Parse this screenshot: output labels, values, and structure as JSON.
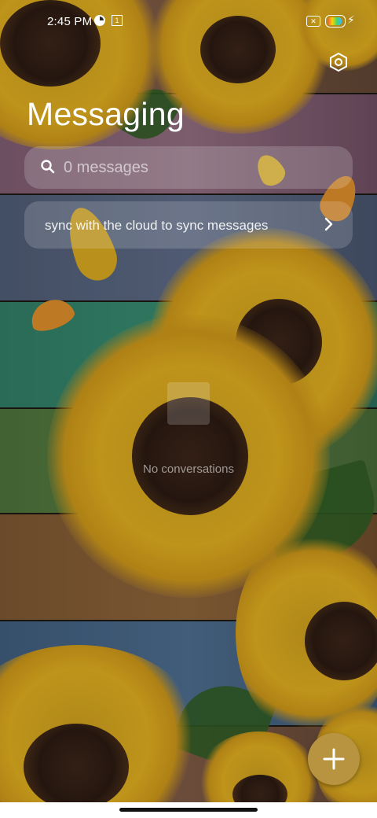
{
  "status_bar": {
    "time": "2:45 PM",
    "sim_label": "1",
    "battery_level": 0.9
  },
  "header": {
    "title": "Messaging",
    "settings_icon": "settings-hexagon-icon"
  },
  "search": {
    "placeholder": "0 messages",
    "icon": "search-icon"
  },
  "sync_banner": {
    "text": "sync with the cloud to sync messages",
    "icon": "chevron-right-icon"
  },
  "empty_state": {
    "text": "No conversations",
    "icon": "message-icon"
  },
  "fab": {
    "icon": "plus-icon",
    "color": "#b89441"
  },
  "colors": {
    "text": "#ffffff",
    "accent": "#b89441"
  }
}
